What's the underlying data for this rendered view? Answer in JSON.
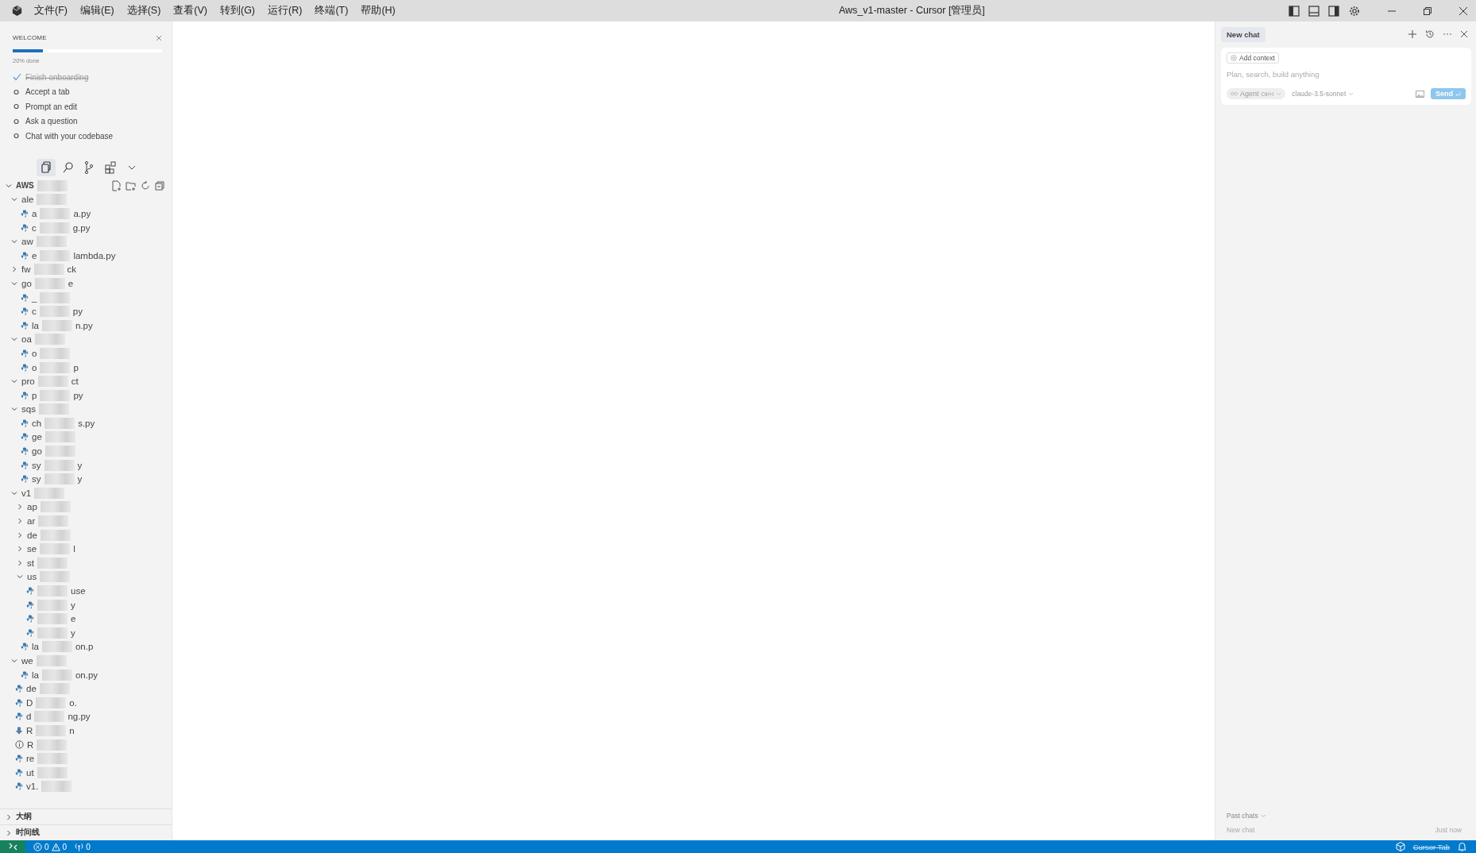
{
  "title_bar": {
    "menus": [
      "文件(F)",
      "编辑(E)",
      "选择(S)",
      "查看(V)",
      "转到(G)",
      "运行(R)",
      "终端(T)",
      "帮助(H)"
    ],
    "title": "Aws_v1-master - Cursor [管理员]"
  },
  "welcome": {
    "title": "WELCOME",
    "level": 0.2,
    "progress_text": "20% done",
    "steps": [
      {
        "label": "Finish onboarding",
        "done": true
      },
      {
        "label": "Accept a tab",
        "done": false
      },
      {
        "label": "Prompt an edit",
        "done": false
      },
      {
        "label": "Ask a question",
        "done": false
      },
      {
        "label": "Chat with your codebase",
        "done": false
      }
    ]
  },
  "explorer": {
    "root": {
      "head": "AWS",
      "kind": "folder",
      "expanded": true,
      "children": [
        {
          "head": "ale",
          "kind": "folder",
          "expanded": true,
          "children": [
            {
              "head": "a",
              "tail": "a.py",
              "kind": "python"
            },
            {
              "head": "c",
              "tail": "g.py",
              "kind": "python"
            }
          ]
        },
        {
          "head": "aw",
          "kind": "folder",
          "expanded": true,
          "children": [
            {
              "head": "e",
              "tail": "lambda.py",
              "kind": "python"
            }
          ]
        },
        {
          "head": "fw",
          "tail": "ck",
          "kind": "folder",
          "expanded": false
        },
        {
          "head": "go",
          "tail": "e",
          "kind": "folder",
          "expanded": true,
          "children": [
            {
              "head": "_",
              "kind": "python"
            },
            {
              "head": "c",
              "tail": "py",
              "kind": "python"
            },
            {
              "head": "la",
              "tail": "n.py",
              "kind": "python"
            }
          ]
        },
        {
          "head": "oa",
          "kind": "folder",
          "expanded": true,
          "children": [
            {
              "head": "o",
              "kind": "python"
            },
            {
              "head": "o",
              "tail": "p",
              "kind": "python"
            }
          ]
        },
        {
          "head": "pro",
          "tail": "ct",
          "kind": "folder",
          "expanded": true,
          "children": [
            {
              "head": "p",
              "tail": "py",
              "kind": "python"
            }
          ]
        },
        {
          "head": "sqs",
          "kind": "folder",
          "expanded": true,
          "children": [
            {
              "head": "ch",
              "tail": "s.py",
              "kind": "python"
            },
            {
              "head": "ge",
              "kind": "python"
            },
            {
              "head": "go",
              "kind": "python"
            },
            {
              "head": "sy",
              "tail": "y",
              "kind": "python"
            },
            {
              "head": "sy",
              "tail": "y",
              "kind": "python"
            }
          ]
        },
        {
          "head": "v1",
          "kind": "folder",
          "expanded": true,
          "children": [
            {
              "head": "ap",
              "kind": "folder",
              "expanded": false
            },
            {
              "head": "ar",
              "kind": "folder",
              "expanded": false
            },
            {
              "head": "de",
              "kind": "folder",
              "expanded": false
            },
            {
              "head": "se",
              "tail": "l",
              "kind": "folder",
              "expanded": false
            },
            {
              "head": "st",
              "kind": "folder",
              "expanded": false
            },
            {
              "head": "us",
              "kind": "folder",
              "expanded": true,
              "children": [
                {
                  "tail": "use",
                  "kind": "python"
                },
                {
                  "tail": "y",
                  "kind": "python"
                },
                {
                  "tail": "e",
                  "kind": "python"
                },
                {
                  "tail": "y",
                  "kind": "python"
                }
              ]
            },
            {
              "head": "la",
              "tail": "on.p",
              "kind": "python"
            }
          ]
        },
        {
          "head": "we",
          "kind": "folder",
          "expanded": true,
          "children": [
            {
              "head": "la",
              "tail": "on.py",
              "kind": "python"
            }
          ]
        },
        {
          "head": "de",
          "kind": "python"
        },
        {
          "head": "D",
          "tail": "o.",
          "kind": "python"
        },
        {
          "head": "d",
          "tail": "ng.py",
          "kind": "python"
        },
        {
          "head": "R",
          "tail": "n",
          "kind": "download"
        },
        {
          "head": "R",
          "kind": "info"
        },
        {
          "head": "re",
          "kind": "python"
        },
        {
          "head": "ut",
          "kind": "python"
        },
        {
          "head": "v1.",
          "kind": "python"
        }
      ]
    }
  },
  "panels": [
    {
      "label": "大纲",
      "expanded": false
    },
    {
      "label": "时间线",
      "expanded": false
    }
  ],
  "chat": {
    "tab": "New chat",
    "add_context": "Add context",
    "placeholder": "Plan, search, build anything",
    "mode": "Agent",
    "shortcut": "Ctrl+I",
    "model": "claude-3.5-sonnet",
    "send": "Send",
    "past_chats": "Past chats",
    "history": [
      {
        "title": "New chat",
        "time": "Just now"
      }
    ]
  },
  "status_bar": {
    "errors": "0",
    "warnings": "0",
    "ports": "0",
    "cursor_tab": "Cursor Tab"
  }
}
